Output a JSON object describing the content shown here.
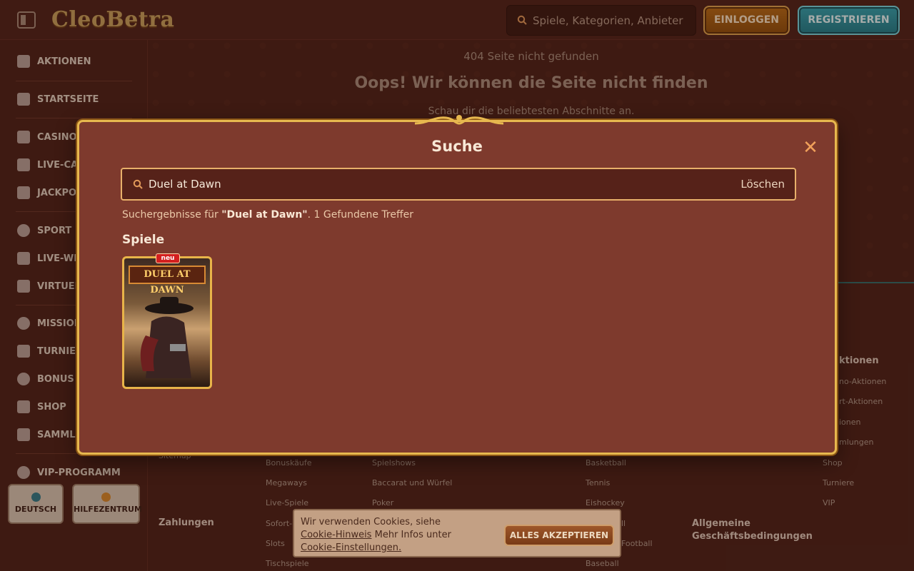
{
  "header": {
    "logo": "CleoBetra",
    "search_placeholder": "Spiele, Kategorien, Anbieter",
    "login_label": "EINLOGGEN",
    "register_label": "REGISTRIEREN"
  },
  "sidebar": {
    "items": [
      {
        "label": "AKTIONEN",
        "icon": "gift-icon"
      },
      {
        "label": "STARTSEITE",
        "icon": "home-icon"
      },
      {
        "label": "CASINO",
        "icon": "slot-icon"
      },
      {
        "label": "LIVE-CA",
        "icon": "card-icon"
      },
      {
        "label": "JACKPO",
        "icon": "clover-icon"
      },
      {
        "label": "SPORT",
        "icon": "ball-icon"
      },
      {
        "label": "LIVE-WE",
        "icon": "live-icon"
      },
      {
        "label": "VIRTUEL",
        "icon": "virtual-icon"
      },
      {
        "label": "MISSION",
        "icon": "target-icon"
      },
      {
        "label": "TURNIER",
        "icon": "trophy-icon"
      },
      {
        "label": "BONUS C",
        "icon": "bonus-icon"
      },
      {
        "label": "SHOP",
        "icon": "shop-icon"
      },
      {
        "label": "SAMMLU",
        "icon": "collection-icon"
      },
      {
        "label": "VIP-PROGRAMM",
        "icon": "vip-icon"
      }
    ],
    "language_label": "DEUTSCH",
    "help_label": "HILFEZENTRUM"
  },
  "page": {
    "subtitle": "404 Seite nicht gefunden",
    "title": "Oops! Wir können die Seite nicht finden",
    "hint": "Schau dir die beliebtesten Abschnitte an."
  },
  "footer": {
    "col1": [
      "Sitemap"
    ],
    "col2": [
      "Bonuskäufe",
      "Megaways",
      "Live-Spiele",
      "Sofort-",
      "Slots",
      "Tischspiele"
    ],
    "col3": [
      "Spielshows",
      "Baccarat und Würfel",
      "Poker"
    ],
    "col4": [
      "Basketball",
      "Tennis",
      "Eishockey",
      "ll",
      "Football",
      "Baseball"
    ],
    "col5_header": "ktionen",
    "col5": [
      "no-Aktionen",
      "rt-Aktionen",
      "ionen",
      "mlungen",
      "Shop",
      "Turniere",
      "VIP"
    ],
    "zahlungen": "Zahlungen",
    "agb": "Allgemeine Geschäftsbedingungen"
  },
  "modal": {
    "title": "Suche",
    "search_value": "Duel at Dawn",
    "clear_label": "Löschen",
    "results_prefix": "Suchergebnisse für ",
    "results_query": "\"Duel at Dawn\"",
    "results_suffix": ". 1 Gefundene Treffer",
    "section_title": "Spiele",
    "game": {
      "title": "DUEL AT DAWN",
      "badge": "neu"
    }
  },
  "cookie": {
    "text_1": "Wir verwenden Cookies, siehe",
    "link_1": "Cookie-Hinweis",
    "text_2": " Mehr Infos unter",
    "link_2": "Cookie-Einstellungen.",
    "accept_label": "ALLES AKZEPTIEREN"
  }
}
